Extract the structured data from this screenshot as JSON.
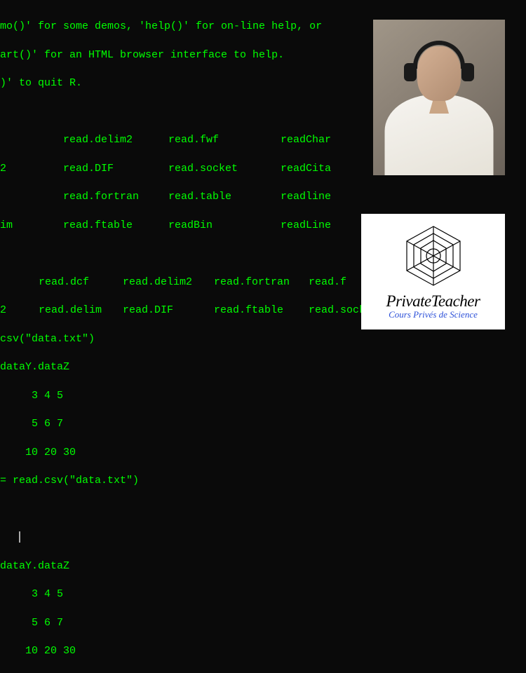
{
  "intro": {
    "l1": "mo()' for some demos, 'help()' for on-line help, or",
    "l2": "art()' for an HTML browser interface to help.",
    "l3": ")' to quit R."
  },
  "block1": {
    "r1": {
      "c1": "",
      "c2": "read.delim2",
      "c3": "read.fwf",
      "c4": "readChar"
    },
    "r2": {
      "c1": "2",
      "c2": "read.DIF",
      "c3": "read.socket",
      "c4": "readCita"
    },
    "r3": {
      "c1": "",
      "c2": "read.fortran",
      "c3": "read.table",
      "c4": "readline"
    },
    "r4": {
      "c1": "im",
      "c2": "read.ftable",
      "c3": "readBin",
      "c4": "readLine"
    }
  },
  "block2": {
    "r1": {
      "c1": "",
      "c2": "read.dcf",
      "c3": "read.delim2",
      "c4": "read.fortran",
      "c5": "read.f"
    },
    "r2": {
      "c1": "2",
      "c2": "read.delim",
      "c3": "read.DIF",
      "c4": "read.ftable",
      "c5": "read.socket"
    }
  },
  "cmds": {
    "csv1": "csv(\"data.txt\")",
    "header": "dataY.dataZ",
    "row1": "     3 4 5",
    "row2": "     5 6 7",
    "row3": "    10 20 30",
    "csv2": "= read.csv(\"data.txt\")"
  },
  "cursor_prefix": "   ",
  "output2": {
    "header": "dataY.dataZ",
    "row1": "     3 4 5",
    "row2": "     5 6 7",
    "row3": "    10 20 30"
  },
  "logo": {
    "title": "PrivateTeacher",
    "subtitle": "Cours Privés de Science"
  }
}
